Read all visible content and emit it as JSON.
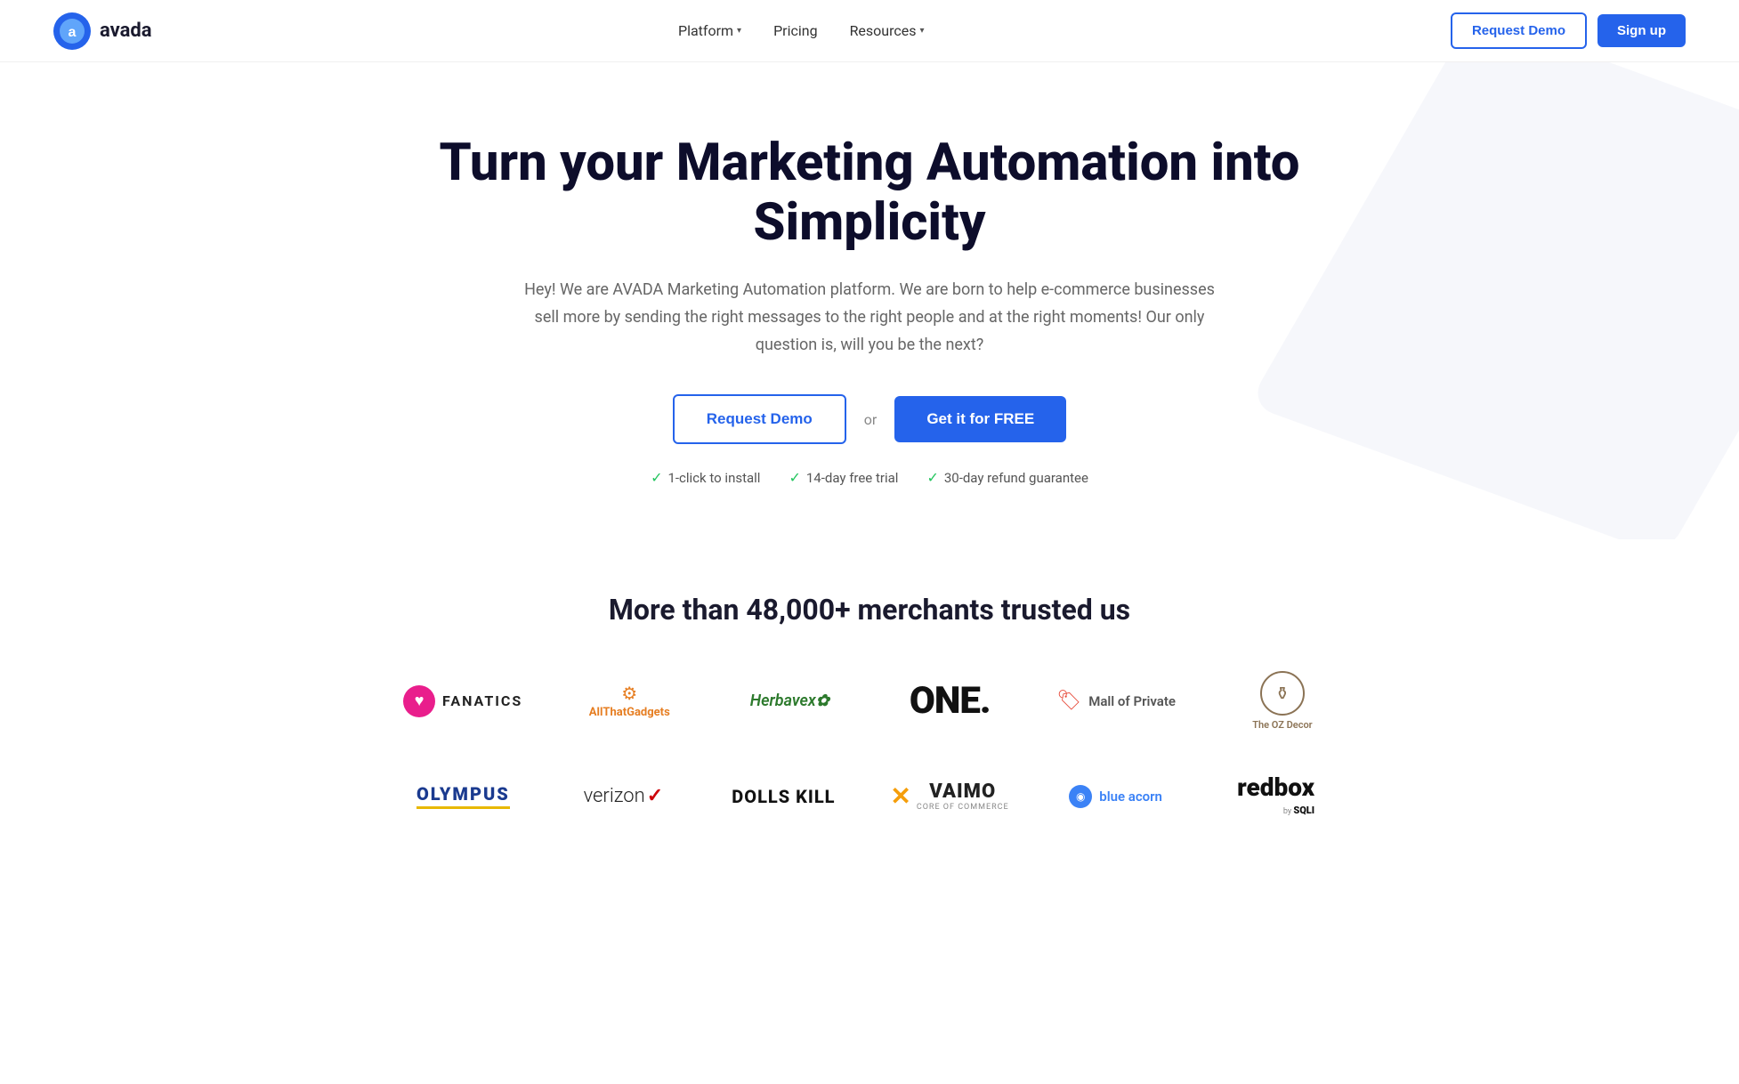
{
  "nav": {
    "logo_text": "avada",
    "platform_label": "Platform",
    "pricing_label": "Pricing",
    "resources_label": "Resources",
    "request_demo_label": "Request Demo",
    "signup_label": "Sign up"
  },
  "hero": {
    "title": "Turn your Marketing Automation into Simplicity",
    "subtitle": "Hey! We are AVADA Marketing Automation platform. We are born to help e-commerce businesses sell more by sending the right messages to the right people and at the right moments! Our only question is, will you be the next?",
    "request_demo_label": "Request Demo",
    "or_text": "or",
    "get_free_label": "Get it for FREE",
    "badge1": "1-click to install",
    "badge2": "14-day free trial",
    "badge3": "30-day refund guarantee"
  },
  "trusted": {
    "title": "More than 48,000+ merchants trusted us",
    "row1": [
      {
        "name": "Fanatics",
        "type": "fanatics"
      },
      {
        "name": "AllThatGadgets",
        "type": "allthat"
      },
      {
        "name": "Herbavex",
        "type": "herbavex"
      },
      {
        "name": "ONE.",
        "type": "one"
      },
      {
        "name": "Mall of Private",
        "type": "mall"
      },
      {
        "name": "The OZ Decor",
        "type": "ozdecor"
      }
    ],
    "row2": [
      {
        "name": "Olympus",
        "type": "olympus"
      },
      {
        "name": "Verizon",
        "type": "verizon"
      },
      {
        "name": "Dolls Kill",
        "type": "dollskill"
      },
      {
        "name": "Vaimo",
        "type": "vaimo"
      },
      {
        "name": "Blue Acorn",
        "type": "blueacorn"
      },
      {
        "name": "Redbox by SQLI",
        "type": "redbox"
      }
    ]
  }
}
